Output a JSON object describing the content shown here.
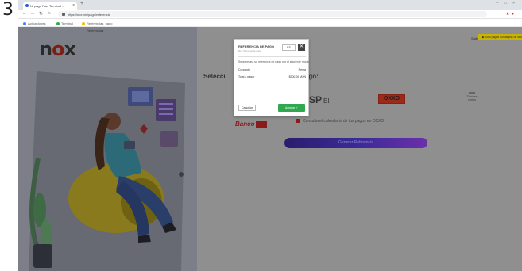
{
  "step_number": "3",
  "browser": {
    "tab_title": "N. pago Fac. Terminal ...",
    "tab_close": "×",
    "new_tab": "+",
    "window_controls": "– □ ×",
    "url": "https://nox.mx/pago/referencia",
    "toolbar_right": "★ ●",
    "bookmarks": [
      "Aplicaciones",
      "Terminal",
      "Referencias_pago"
    ],
    "bookmark_colors": [
      "#4285f4",
      "#34a853",
      "#fbbc05"
    ]
  },
  "page": {
    "breadcrumb": "Referencias",
    "logo_prefix": "n",
    "logo_o": "o",
    "logo_suffix": "x",
    "login_link": "Salir",
    "banner_text": "▶ Sólo pagos con tarjeta de débito/crédito",
    "section_title_left": "Selecci",
    "section_title_right": "pago:",
    "banks": {
      "b_main": "SP",
      "b_small": "EI",
      "oxxo": "OXXO",
      "other_line1": "Tiendas",
      "other_line2": "y más",
      "red_brand": "Banco",
      "red_tag": " "
    },
    "info_text": "Consulta el calendario de tus pagos en OXXO",
    "cta_label": "Generar Referencia"
  },
  "modal": {
    "title": "REFERENCIA DE PAGO",
    "subtitle": "Nox Terminal de pago",
    "language": "ES",
    "close": "✕",
    "message": "Se generará su referencia de pago por el siguiente monto",
    "rows": [
      {
        "label": "Concepto",
        "value": "Renta"
      },
      {
        "label": "Total a pagar",
        "value": "$300.00 MXN"
      }
    ],
    "cancel_label": "Cancelar",
    "accept_label": "Aceptar ✓"
  }
}
